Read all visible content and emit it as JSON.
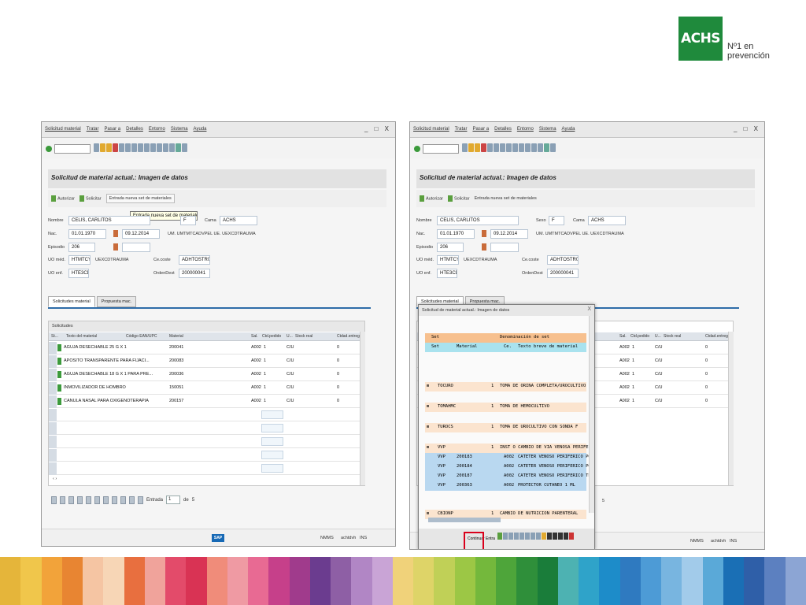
{
  "brand": {
    "logo_text": "ACHS",
    "slogan_line1": "Nº1 en",
    "slogan_line2": "prevención",
    "color": "#1f8a3c"
  },
  "stripes": [
    "#e5b53a",
    "#f0c64b",
    "#f2a33a",
    "#e88532",
    "#f5c5a3",
    "#f7d6b6",
    "#e86f3f",
    "#f0a39b",
    "#e34b6a",
    "#d93354",
    "#f08c7a",
    "#ef9aa3",
    "#e86a93",
    "#c6408a",
    "#a03b8c",
    "#6b3c8f",
    "#8e5fa5",
    "#b186c5",
    "#c9a4d6",
    "#f0d27a",
    "#ded468",
    "#c0d057",
    "#9cc745",
    "#74b83c",
    "#4ea53a",
    "#2f8f3a",
    "#1a7d3a",
    "#4db2b2",
    "#2fa3c9",
    "#1d8cc9",
    "#2f7ac0",
    "#4d9bd6",
    "#78b5e0",
    "#a2cbea",
    "#5aa9d8",
    "#1a6fb5",
    "#2f5fa8",
    "#5c80c0",
    "#8ca5d4"
  ],
  "left": {
    "title_menu": [
      "Solicitud material",
      "Tratar",
      "Pasar a",
      "Detalles",
      "Entorno",
      "Sistema",
      "Ayuda"
    ],
    "window_controls": "_ □ X",
    "section_title": "Solicitud de material actual.: Imagen de datos",
    "actions": {
      "autorizar": "Autorizar",
      "solicitar": "Solicitar",
      "entrada": "Entrada nueva set de materiales"
    },
    "tooltip": "Entrada nueva set de materiales   (Ctrl+F1)",
    "form": {
      "nombre_label": "Nombre",
      "nombre": "CELIS, CARLITOS",
      "sexo_val": "F",
      "cama_label": "Cama",
      "cama": "ACHS",
      "nac_label": "Nac.",
      "nac": "01.01.1970",
      "fecha": "09.12.2014",
      "um_text": "UM. UMTMTCADVPEL  UE. UEXCDTRAUMA",
      "episodio_label": "Episodio",
      "episodio": "206",
      "uo_med_label": "UO méd.",
      "uo_med": "HTMTCYP",
      "uo_med_text": "UEXCDTRAUMA",
      "ce_coste_label": "Ce.coste",
      "ce_coste": "ADHTOSTR01",
      "uo_enf_label": "UO enf.",
      "uo_enf": "HTE3CDT",
      "orden_label": "OrdenDest",
      "orden": "200000041"
    },
    "tabs": [
      "Solicitudes material",
      "Propuesta mac."
    ],
    "grid": {
      "header": "Solicitudes",
      "columns": [
        "St...",
        "Texto del material",
        "Código EAN/UPC",
        "Material",
        "Sal.",
        "Ctd.pedido",
        "U...",
        "Stock real",
        "Ctdad.entrega"
      ],
      "rows": [
        {
          "texto": "AGUJA DESECHABLE 25 G X 1",
          "material": "200041",
          "sal": "A002",
          "ctd": "1",
          "u": "C/U",
          "entrega": "0"
        },
        {
          "texto": "APOSITO TRANSPARENTE PARA FIJACI...",
          "material": "200083",
          "sal": "A002",
          "ctd": "1",
          "u": "C/U",
          "entrega": "0"
        },
        {
          "texto": "AGUJA DESECHABLE 18 G X 1 PARA PRE...",
          "material": "200036",
          "sal": "A002",
          "ctd": "1",
          "u": "C/U",
          "entrega": "0"
        },
        {
          "texto": "INMOVILIZADOR DE HOMBRO",
          "material": "150051",
          "sal": "A002",
          "ctd": "1",
          "u": "C/U",
          "entrega": "0"
        },
        {
          "texto": "CANULA NASAL PARA OXIGENOTERAPIA",
          "material": "200157",
          "sal": "A002",
          "ctd": "1",
          "u": "C/U",
          "entrega": "0"
        }
      ],
      "scroll_marks": "‹ ›"
    },
    "pager": {
      "entrada_label": "Entrada",
      "entrada": "1",
      "de_label": "de",
      "total": "5"
    },
    "status": {
      "system": "NMMS",
      "user": "achtdvh",
      "ins": "INS"
    },
    "sap": "SAP"
  },
  "right": {
    "title_menu": [
      "Solicitud material",
      "Tratar",
      "Pasar a",
      "Detalles",
      "Entorno",
      "Sistema",
      "Ayuda"
    ],
    "window_controls": "_ □ X",
    "section_title": "Solicitud de material actual.: Imagen de datos",
    "actions": {
      "autorizar": "Autorizar",
      "solicitar": "Solicitar",
      "entrada": "Entrada nueva set de materiales"
    },
    "form": {
      "nombre_label": "Nombre",
      "nombre": "CELIS, CARLITOS",
      "sexo_label": "Sexo",
      "sexo": "F",
      "cama_label": "Cama",
      "cama": "ACHS",
      "nac_label": "Nac.",
      "nac": "01.01.1970",
      "fecha": "09.12.2014",
      "um_text": "UM. UMTMTCADVPEL  UE. UEXCDTRAUMA",
      "episodio_label": "Episodio",
      "episodio": "206",
      "uo_med_label": "UO méd.",
      "uo_med": "HTMTCYP",
      "uo_med_text": "UEXCDTRAUMA",
      "ce_coste_label": "Ce.coste",
      "ce_coste": "ADHTOSTR01",
      "uo_enf_label": "UO enf.",
      "uo_enf": "HTE3CDT",
      "orden_label": "OrdenDest",
      "orden": "200000041"
    },
    "tabs": [
      "Solicitudes material",
      "Propuesta mac."
    ],
    "grid_columns": [
      "Sal.",
      "Ctd.pedido",
      "U...",
      "Stock real",
      "Ctdad.entrega"
    ],
    "grid_rows": [
      {
        "sal": "A002",
        "ctd": "1",
        "u": "C/U",
        "entrega": "0"
      },
      {
        "sal": "A002",
        "ctd": "1",
        "u": "C/U",
        "entrega": "0"
      },
      {
        "sal": "A002",
        "ctd": "1",
        "u": "C/U",
        "entrega": "0"
      },
      {
        "sal": "A002",
        "ctd": "1",
        "u": "C/U",
        "entrega": "0"
      },
      {
        "sal": "A002",
        "ctd": "1",
        "u": "C/U",
        "entrega": "0"
      }
    ],
    "pager_total": "5",
    "status": {
      "system": "NMMS",
      "user": "achtdvh",
      "ins": "INS"
    },
    "popup": {
      "title": "Solicitud de material actual.: Imagen de datos",
      "header1": {
        "a": "Set",
        "b": "Denominación de set"
      },
      "header2": {
        "a": "Set",
        "b": "Material",
        "c": "Ce.",
        "d": "Texto breve de material"
      },
      "sets": [
        {
          "code": "TOCURO",
          "qty": "1",
          "desc": "TOMA DE ORINA COMPLETA/UROCULTIVO"
        },
        {
          "code": "TOMAHMC",
          "qty": "1",
          "desc": "TOMA DE HEMOCULTIVO"
        },
        {
          "code": "TUROCS",
          "qty": "1",
          "desc": "TOMA DE UROCULTIVO CON SONDA F"
        },
        {
          "code": "VVP",
          "qty": "1",
          "desc": "INST O CAMBIO DE VIA VENOSA PERIFERICA"
        }
      ],
      "items": [
        {
          "set": "VVP",
          "mat": "200183",
          "ce": "A002",
          "desc": "CATETER VENOSO PERIFERICO POLIUR"
        },
        {
          "set": "VVP",
          "mat": "200184",
          "ce": "A002",
          "desc": "CATETER VENOSO PERIFERICO POLIUR"
        },
        {
          "set": "VVP",
          "mat": "200187",
          "ce": "A002",
          "desc": "CATETER VENOSO PERIFERICO TEFLON"
        },
        {
          "set": "VVP",
          "mat": "200363",
          "ce": "A002",
          "desc": "PROTECTOR CUTANEO 1 ML"
        }
      ],
      "last_set": {
        "code": "CBIONP",
        "qty": "1",
        "desc": "CAMBIO DE NUTRICION PARENTERAL"
      },
      "btn_continuar": "Continuar",
      "btn_entry": "Entra",
      "close": "X"
    }
  }
}
